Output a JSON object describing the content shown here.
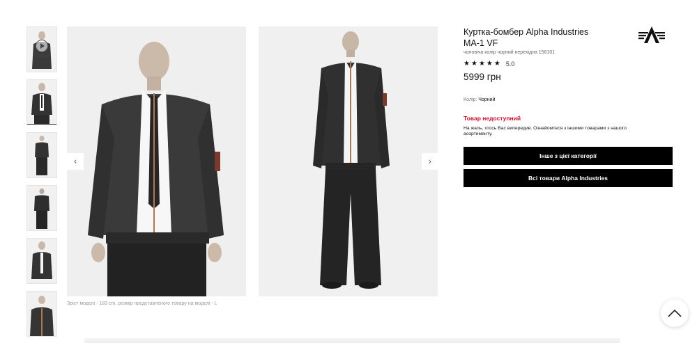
{
  "gallery": {
    "video_label": "Video",
    "prev_icon": "chevron-left-icon",
    "next_icon": "chevron-right-icon",
    "caption": "Зріст моделі - 183 cm, розмір представленого товару на моделі - L"
  },
  "product": {
    "title_line1": "Куртка-бомбер Alpha Industries",
    "title_line2": "MA-1 VF",
    "subtitle": "чоловіча колір чорний перехідна 156101",
    "rating_value": "5.0",
    "rating_stars": 5,
    "price": "5999 грн",
    "color_label": "Колір:",
    "color_value": "Чорний",
    "unavailable_title": "Товар недоступний",
    "unavailable_message": "На жаль, хтось Вас випередив. Ознайомтеся з іншими товарами з нашого асортименту.",
    "button_category": "Інше з цієї категорії",
    "button_brand": "Всі товари Alpha Industries"
  },
  "brand": {
    "logo_icon": "alpha-industries-logo"
  },
  "colors": {
    "unavailable": "#c8102e",
    "button_bg": "#000000"
  }
}
